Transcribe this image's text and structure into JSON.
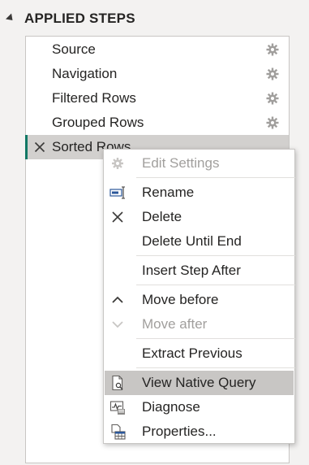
{
  "pane": {
    "title": "APPLIED STEPS"
  },
  "steps": [
    {
      "label": "Source",
      "has_settings": true
    },
    {
      "label": "Navigation",
      "has_settings": true
    },
    {
      "label": "Filtered Rows",
      "has_settings": true
    },
    {
      "label": "Grouped Rows",
      "has_settings": true
    },
    {
      "label": "Sorted Rows",
      "has_settings": false,
      "selected": true
    }
  ],
  "context_menu": {
    "items": [
      {
        "label": "Edit Settings",
        "icon": "gear-icon",
        "enabled": false
      },
      {
        "label": "Rename",
        "icon": "rename-icon",
        "enabled": true
      },
      {
        "label": "Delete",
        "icon": "close-icon",
        "enabled": true
      },
      {
        "label": "Delete Until End",
        "icon": "",
        "enabled": true
      },
      {
        "label": "Insert Step After",
        "icon": "",
        "enabled": true
      },
      {
        "label": "Move before",
        "icon": "chevron-up-icon",
        "enabled": true
      },
      {
        "label": "Move after",
        "icon": "chevron-down-icon",
        "enabled": false
      },
      {
        "label": "Extract Previous",
        "icon": "",
        "enabled": true
      },
      {
        "label": "View Native Query",
        "icon": "native-query-icon",
        "enabled": true,
        "hovered": true
      },
      {
        "label": "Diagnose",
        "icon": "diagnose-icon",
        "enabled": true
      },
      {
        "label": "Properties...",
        "icon": "properties-icon",
        "enabled": true
      }
    ]
  },
  "colors": {
    "accent": "#117865",
    "selected_bg": "#d2d0ce",
    "hover_bg": "#c8c6c4",
    "disabled_text": "#a19f9d"
  }
}
